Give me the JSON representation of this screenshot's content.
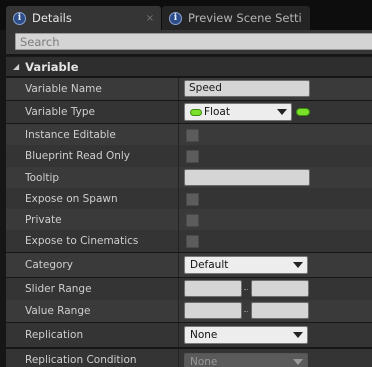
{
  "tabs": [
    {
      "label": "Details",
      "close": "×"
    },
    {
      "label": "Preview Scene Setti",
      "close": "×"
    }
  ],
  "search": {
    "placeholder": "Search"
  },
  "category": {
    "label": "Variable"
  },
  "rows": {
    "variable_name": {
      "label": "Variable Name",
      "value": "Speed"
    },
    "variable_type": {
      "label": "Variable Type",
      "value": "Float"
    },
    "instance_editable": {
      "label": "Instance Editable",
      "checked": false
    },
    "blueprint_read_only": {
      "label": "Blueprint Read Only",
      "checked": false
    },
    "tooltip": {
      "label": "Tooltip",
      "value": ""
    },
    "expose_on_spawn": {
      "label": "Expose on Spawn",
      "checked": false
    },
    "private": {
      "label": "Private",
      "checked": false
    },
    "expose_to_cinematics": {
      "label": "Expose to Cinematics",
      "checked": false
    },
    "category": {
      "label": "Category",
      "value": "Default"
    },
    "slider_range": {
      "label": "Slider Range",
      "min": "",
      "max": ""
    },
    "value_range": {
      "label": "Value Range",
      "min": "",
      "max": ""
    },
    "replication": {
      "label": "Replication",
      "value": "None"
    },
    "replication_condition": {
      "label": "Replication Condition",
      "value": "None"
    }
  },
  "colors": {
    "float_pin": "#7be02a",
    "info_icon": "#2c4d8a"
  },
  "icons": {
    "tab_icon": "info-icon",
    "type_pin": "float-pin-icon"
  }
}
